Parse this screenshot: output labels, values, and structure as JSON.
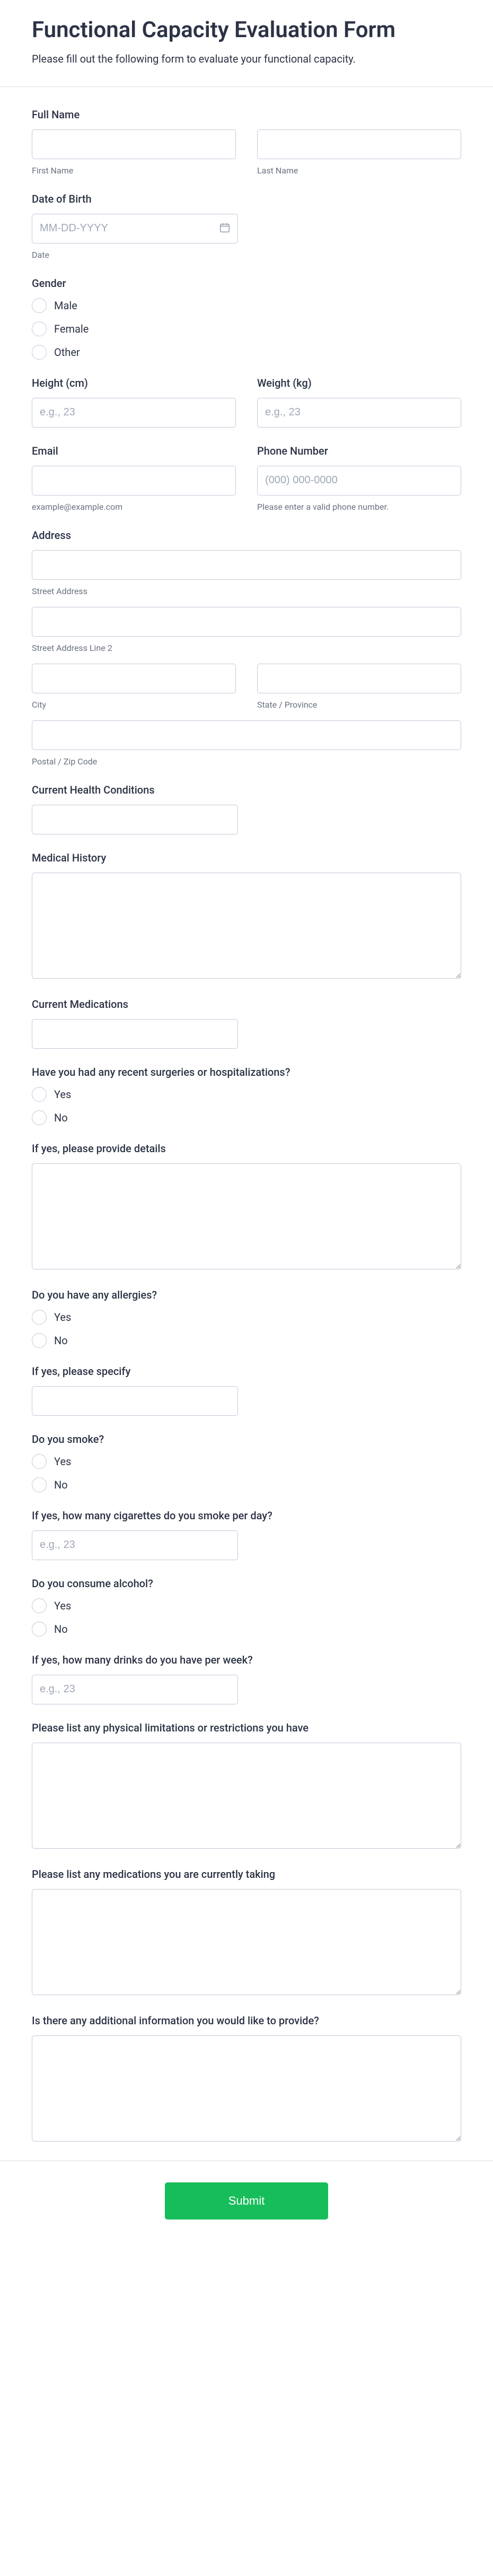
{
  "header": {
    "title": "Functional Capacity Evaluation Form",
    "subtitle": "Please fill out the following form to evaluate your functional capacity."
  },
  "fullName": {
    "label": "Full Name",
    "firstSub": "First Name",
    "lastSub": "Last Name"
  },
  "dob": {
    "label": "Date of Birth",
    "placeholder": "MM-DD-YYYY",
    "sub": "Date"
  },
  "gender": {
    "label": "Gender",
    "options": [
      "Male",
      "Female",
      "Other"
    ]
  },
  "height": {
    "label": "Height (cm)",
    "placeholder": "e.g., 23"
  },
  "weight": {
    "label": "Weight (kg)",
    "placeholder": "e.g., 23"
  },
  "email": {
    "label": "Email",
    "sub": "example@example.com"
  },
  "phone": {
    "label": "Phone Number",
    "placeholder": "(000) 000-0000",
    "sub": "Please enter a valid phone number."
  },
  "address": {
    "label": "Address",
    "streetSub": "Street Address",
    "street2Sub": "Street Address Line 2",
    "citySub": "City",
    "stateSub": "State / Province",
    "postalSub": "Postal / Zip Code"
  },
  "healthConditions": {
    "label": "Current Health Conditions"
  },
  "medicalHistory": {
    "label": "Medical History"
  },
  "currentMedications": {
    "label": "Current Medications"
  },
  "recentSurgery": {
    "label": "Have you had any recent surgeries or hospitalizations?",
    "options": [
      "Yes",
      "No"
    ]
  },
  "surgeryDetails": {
    "label": "If yes, please provide details"
  },
  "allergies": {
    "label": "Do you have any allergies?",
    "options": [
      "Yes",
      "No"
    ]
  },
  "allergySpecify": {
    "label": "If yes, please specify"
  },
  "smoke": {
    "label": "Do you smoke?",
    "options": [
      "Yes",
      "No"
    ]
  },
  "cigarettes": {
    "label": "If yes, how many cigarettes do you smoke per day?",
    "placeholder": "e.g., 23"
  },
  "alcohol": {
    "label": "Do you consume alcohol?",
    "options": [
      "Yes",
      "No"
    ]
  },
  "drinks": {
    "label": "If yes, how many drinks do you have per week?",
    "placeholder": "e.g., 23"
  },
  "physicalLimitations": {
    "label": "Please list any physical limitations or restrictions you have"
  },
  "medicationsTaking": {
    "label": "Please list any medications you are currently taking"
  },
  "additionalInfo": {
    "label": "Is there any additional information you would like to provide?"
  },
  "submit": {
    "label": "Submit"
  }
}
